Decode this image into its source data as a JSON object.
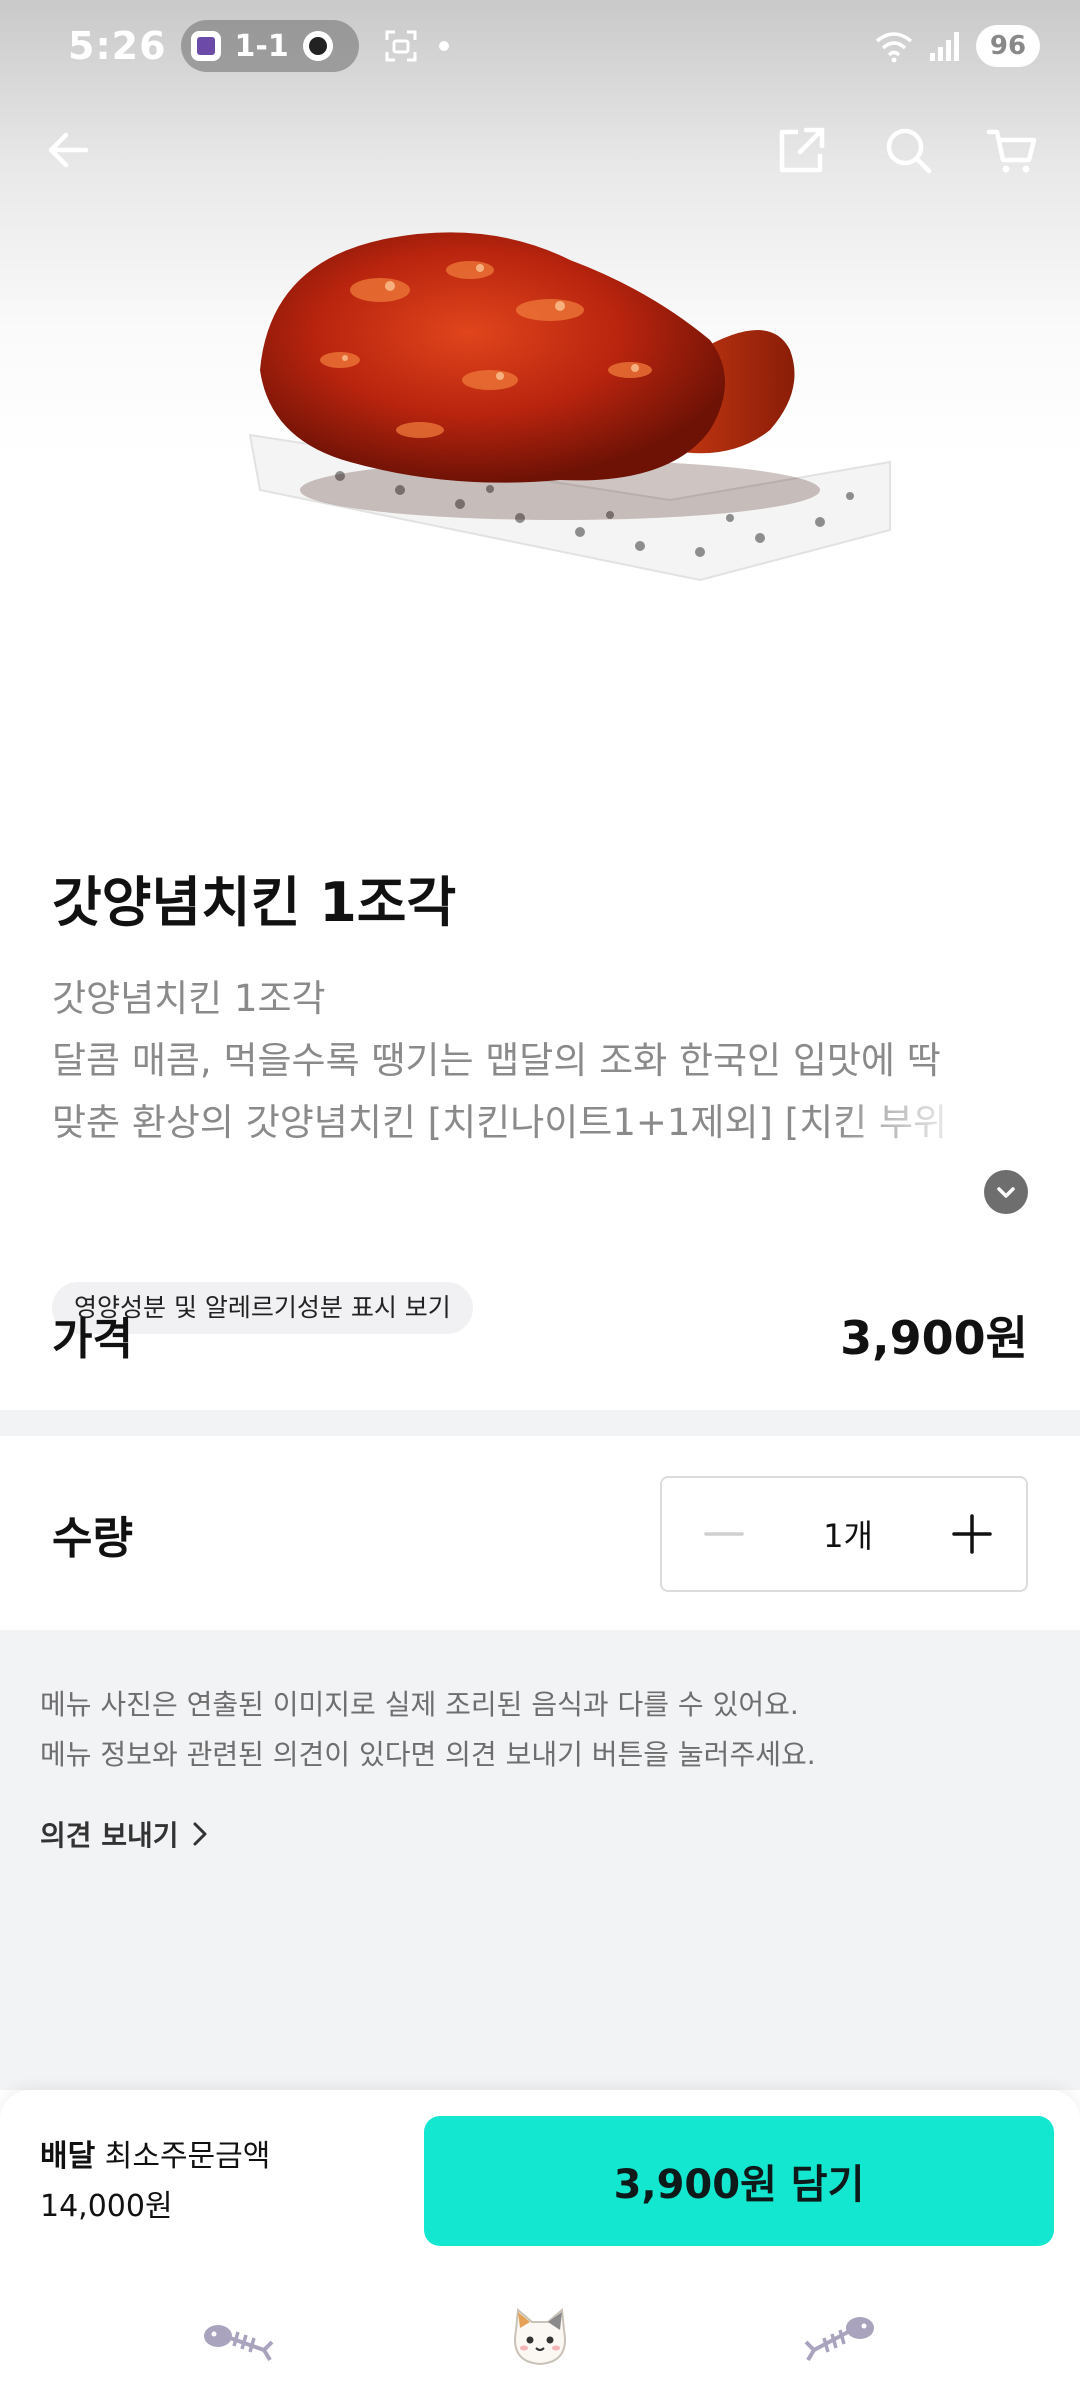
{
  "status_bar": {
    "time": "5:26",
    "score": "1-1",
    "battery": "96"
  },
  "nav": {
    "back_icon": "back-arrow-icon",
    "share_icon": "share-icon",
    "search_icon": "search-icon",
    "cart_icon": "cart-icon"
  },
  "product": {
    "title": "갓양념치킨 1조각",
    "description_lines": [
      "갓양념치킨 1조각",
      "달콤 매콤, 먹을수록 땡기는 맵달의 조화 한국인 입맛에 딱",
      "맞춘 환상의 갓양념치킨 [치킨나이트1+1제외] [치킨 부위"
    ],
    "nutrition_chip": "영양성분 및 알레르기성분 표시 보기"
  },
  "price": {
    "label": "가격",
    "value": "3,900원"
  },
  "quantity": {
    "label": "수량",
    "value": "1개"
  },
  "notice": {
    "lines": [
      "메뉴 사진은 연출된 이미지로 실제 조리된 음식과 다를 수 있어요.",
      "메뉴 정보와 관련된 의견이 있다면 의견 보내기 버튼을 눌러주세요."
    ],
    "feedback_link": "의견 보내기"
  },
  "bottom_bar": {
    "delivery_label": "배달",
    "min_order_label": "최소주문금액",
    "min_order_value": "14,000원",
    "add_button": "3,900원 담기"
  },
  "colors": {
    "accent": "#13e7cf",
    "background_grey": "#f2f3f5",
    "muted_text": "#8a8a8a"
  }
}
